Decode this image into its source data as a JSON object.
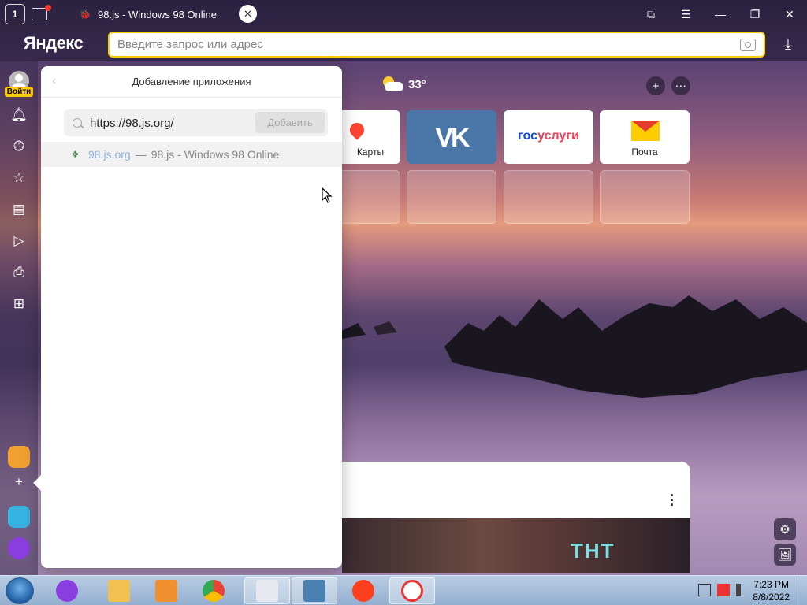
{
  "browser": {
    "tab_counter": "1",
    "tab": {
      "title": "98.js - Windows 98 Online",
      "favicon": "globe-icon"
    },
    "logo": "Яндекс",
    "omnibox": {
      "placeholder": "Введите запрос или адрес",
      "value": ""
    },
    "window_controls": [
      "bookmarks-icon",
      "menu-icon",
      "minimize-icon",
      "restore-icon",
      "close-icon"
    ]
  },
  "sidebar": {
    "login_label": "Войти",
    "items": [
      "bell-icon",
      "history-icon",
      "star-icon",
      "collections-icon",
      "video-icon",
      "screenshot-icon",
      "apps-icon"
    ],
    "apps": [
      "mail-app",
      "add-app",
      "zen-app",
      "alice-app"
    ]
  },
  "panel": {
    "title": "Добавление приложения",
    "url_value": "https://98.js.org/",
    "add_button": "Добавить",
    "suggestion": {
      "domain": "98.js.org",
      "separator": "—",
      "title": "98.js - Windows 98 Online"
    }
  },
  "newtab": {
    "weather": "33°",
    "tiles": [
      {
        "label": "Карты",
        "kind": "maps"
      },
      {
        "label": "",
        "kind": "vk",
        "text": "VK"
      },
      {
        "label": "",
        "kind": "gosuslugi",
        "text_a": "гос",
        "text_b": "услуги"
      },
      {
        "label": "Почта",
        "kind": "mail"
      }
    ]
  },
  "feed": {
    "brand": "ТНТ"
  },
  "taskbar": {
    "apps": [
      "alice-icon",
      "explorer-icon",
      "media-player-icon",
      "chrome-icon",
      "paint-icon",
      "photos-icon",
      "yandex-icon",
      "yandex-browser-icon"
    ],
    "clock_time": "7:23 PM",
    "clock_date": "8/8/2022"
  },
  "colors": {
    "accent": "#ffcc00",
    "vk": "#4a76a8",
    "alert": "#ff3b30"
  }
}
